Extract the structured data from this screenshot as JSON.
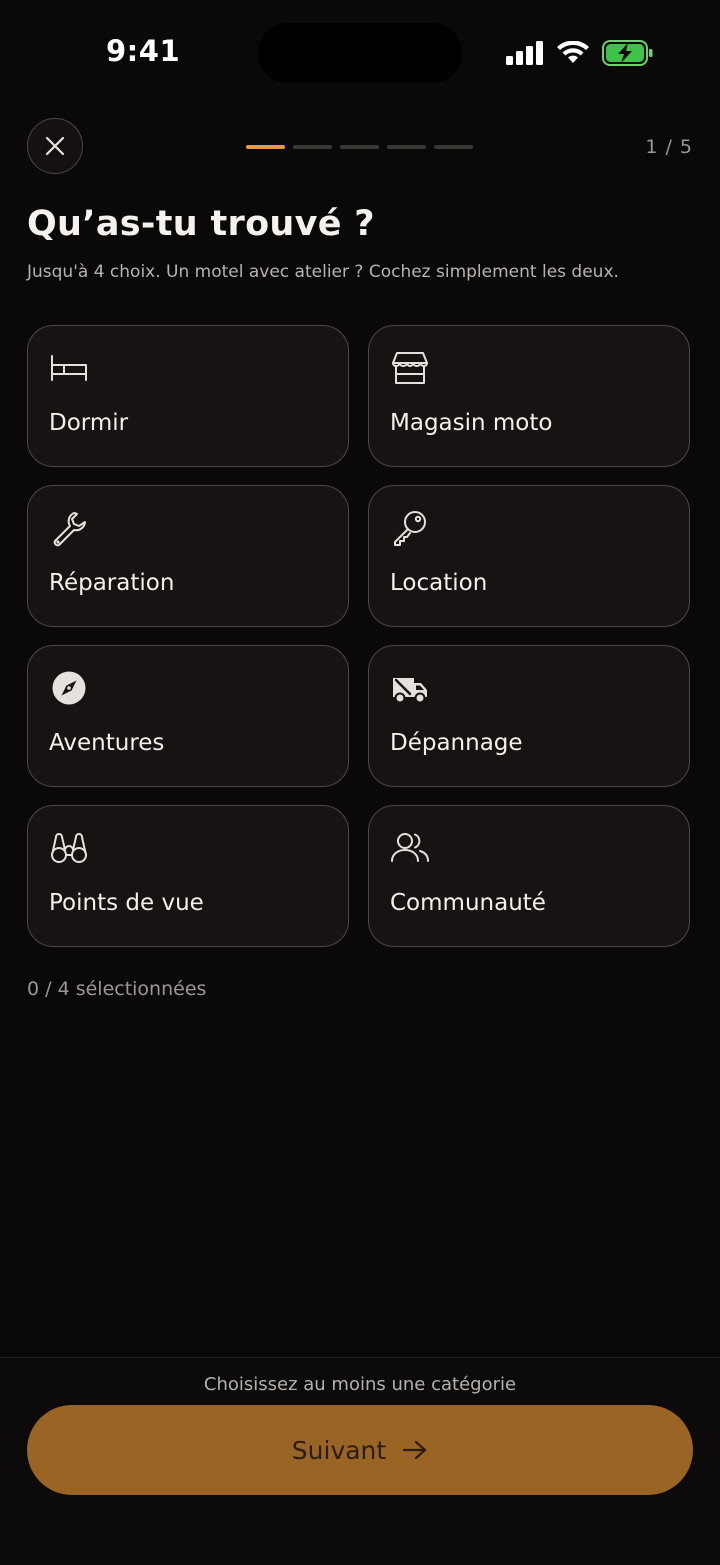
{
  "status_bar": {
    "time": "9:41"
  },
  "header": {
    "step_counter": "1 / 5",
    "progress": {
      "total_steps": 5,
      "current_step": 1
    }
  },
  "title": "Qu’as-tu trouvé ?",
  "subtitle": "Jusqu'à 4 choix. Un motel avec atelier ? Cochez simplement les deux.",
  "categories": [
    {
      "label": "Dormir",
      "icon": "bed-icon"
    },
    {
      "label": "Magasin moto",
      "icon": "storefront-icon"
    },
    {
      "label": "Réparation",
      "icon": "wrench-icon"
    },
    {
      "label": "Location",
      "icon": "key-icon"
    },
    {
      "label": "Aventures",
      "icon": "compass-icon"
    },
    {
      "label": "Dépannage",
      "icon": "tow-truck-icon"
    },
    {
      "label": "Points de vue",
      "icon": "binoculars-icon"
    },
    {
      "label": "Communauté",
      "icon": "users-icon"
    }
  ],
  "selection": {
    "count_text": "0 / 4 sélectionnées"
  },
  "footer": {
    "hint": "Choisissez au moins une catégorie",
    "next_label": "Suivant"
  },
  "colors": {
    "background": "#0a0808",
    "accent": "#e89a3c",
    "button": "#9a6425",
    "card_border": "#4e4947"
  }
}
